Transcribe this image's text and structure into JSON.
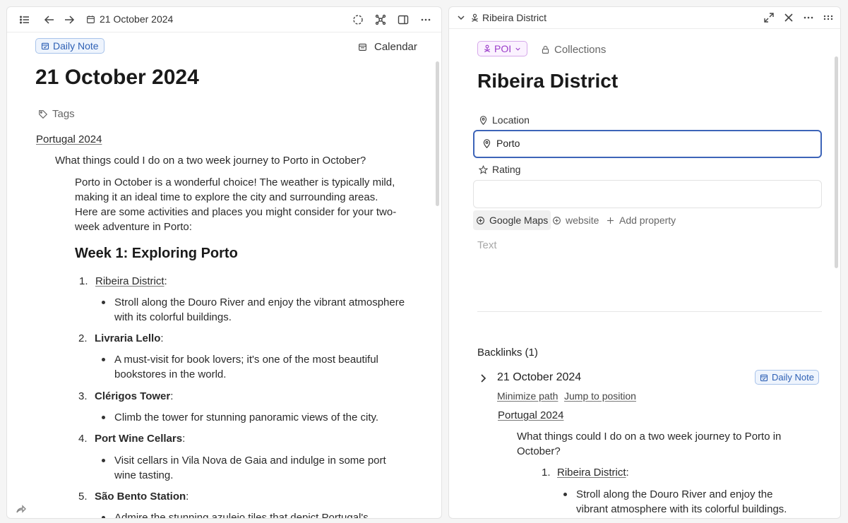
{
  "left": {
    "toolbar": {
      "date": "21 October 2024"
    },
    "daily_note_chip": "Daily Note",
    "calendar_label": "Calendar",
    "title": "21 October 2024",
    "tags_label": "Tags",
    "breadcrumb": "Portugal 2024",
    "question": "What things could I do on a two week journey to Porto in October?",
    "answer_lines": [
      "Porto in October is a wonderful choice! The weather is typically mild,",
      "making it an ideal time to explore the city and surrounding areas.",
      "Here are some activities and places you might consider for your two-",
      "week adventure in Porto:"
    ],
    "week_heading": "Week 1: Exploring Porto",
    "items": [
      {
        "num": "1.",
        "name": "Ribeira District",
        "desc": [
          "Stroll along the Douro River and enjoy the vibrant atmosphere",
          "with its colorful buildings."
        ]
      },
      {
        "num": "2.",
        "name": "Livraria Lello",
        "desc": [
          "A must-visit for book lovers; it's one of the most beautiful",
          "bookstores in the world."
        ]
      },
      {
        "num": "3.",
        "name": "Clérigos Tower",
        "desc": [
          "Climb the tower for stunning panoramic views of the city."
        ]
      },
      {
        "num": "4.",
        "name": "Port Wine Cellars",
        "desc": [
          "Visit cellars in Vila Nova de Gaia and indulge in some port",
          "wine tasting."
        ]
      },
      {
        "num": "5.",
        "name": "São Bento Station",
        "desc": [
          "Admire the stunning azulejo tiles that depict Portugal's"
        ]
      }
    ],
    "colon": ":"
  },
  "right": {
    "toolbar": {
      "title": "Ribeira District"
    },
    "type_chip": "POI",
    "collections_label": "Collections",
    "title": "Ribeira District",
    "location_label": "Location",
    "location_value": "Porto",
    "rating_label": "Rating",
    "property_buttons": [
      "Google Maps",
      "website",
      "Add property"
    ],
    "text_placeholder": "Text",
    "backlinks_label": "Backlinks (1)",
    "backlink": {
      "title": "21 October 2024",
      "chip": "Daily Note",
      "minimize": "Minimize path",
      "jump": "Jump to position",
      "breadcrumb": "Portugal 2024",
      "question_lines": [
        "What things could I do on a two week journey to Porto in",
        "October?"
      ],
      "item_num": "1.",
      "item_name": "Ribeira District",
      "colon": ":",
      "item_desc": [
        "Stroll along the Douro River and enjoy the",
        "vibrant atmosphere with its colorful buildings."
      ]
    }
  },
  "colors": {
    "accent": "#3d64b8",
    "chip_blue": "#2f61b5",
    "chip_purple": "#9b3cc9"
  }
}
